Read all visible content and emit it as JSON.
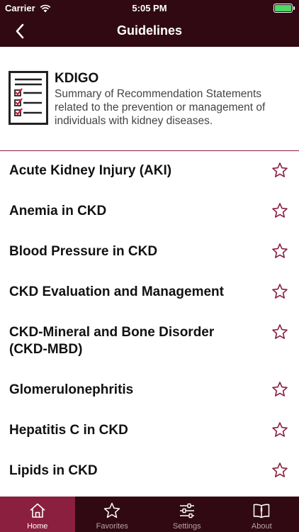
{
  "status_bar": {
    "carrier": "Carrier",
    "time": "5:05 PM"
  },
  "nav": {
    "title": "Guidelines"
  },
  "intro": {
    "title": "KDIGO",
    "description": "Summary of Recommendation Statements related to the prevention or management of individuals with kidney diseases."
  },
  "guidelines": [
    {
      "label": "Acute Kidney Injury (AKI)"
    },
    {
      "label": "Anemia in CKD"
    },
    {
      "label": "Blood Pressure in CKD"
    },
    {
      "label": "CKD Evaluation and Management"
    },
    {
      "label": "CKD-Mineral and Bone Disorder (CKD-MBD)"
    },
    {
      "label": "Glomerulonephritis"
    },
    {
      "label": "Hepatitis C in CKD"
    },
    {
      "label": "Lipids in CKD"
    }
  ],
  "tabs": [
    {
      "label": "Home",
      "icon": "home-icon",
      "active": true
    },
    {
      "label": "Favorites",
      "icon": "star-icon",
      "active": false
    },
    {
      "label": "Settings",
      "icon": "sliders-icon",
      "active": false
    },
    {
      "label": "About",
      "icon": "book-icon",
      "active": false
    }
  ],
  "colors": {
    "brand": "#300912",
    "accent": "#8a1f3f",
    "battery": "#4cd964"
  }
}
